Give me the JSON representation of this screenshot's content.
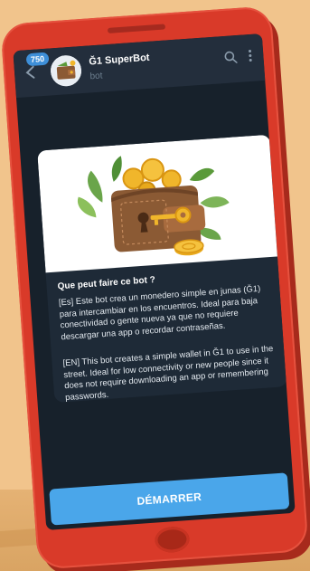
{
  "header": {
    "unread_count": "750",
    "bot_name": "Ğ1 SuperBot",
    "bot_status": "bot",
    "back_icon": "arrow-left-icon",
    "search_icon": "search-icon",
    "menu_icon": "more-vertical-icon"
  },
  "card": {
    "image_description_icon": "wallet-key-illustration",
    "title": "Que peut faire ce bot ?",
    "paragraph_es": "[Es] Este bot crea un monedero simple en junas (Ğ1) para intercambiar en los encuentros. Ideal para baja conectividad o gente nueva ya que no requiere descargar una app o recordar contraseñas.",
    "paragraph_en": "[EN] This bot creates a simple wallet in Ğ1 to use in the street. Ideal for low connectivity or new people since it does not require downloading an app or remembering passwords."
  },
  "start_button": {
    "label": "DÉMARRER"
  },
  "colors": {
    "background": "#f1c48c",
    "phone_body": "#d93a29",
    "screen": "#17212b",
    "header": "#232e3c",
    "card": "#1e2a37",
    "accent": "#4aa6ea"
  }
}
